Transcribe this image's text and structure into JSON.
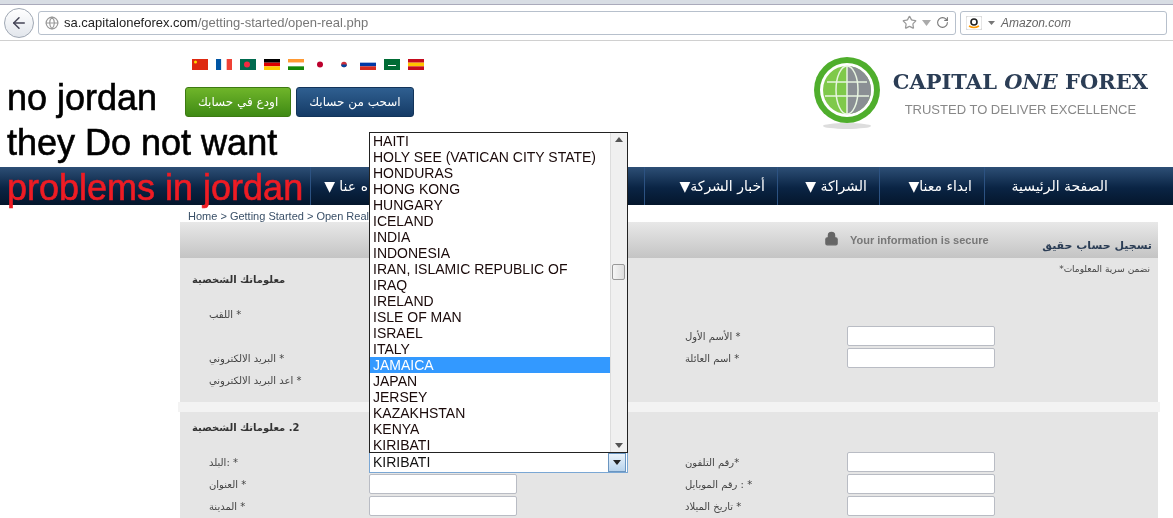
{
  "browser": {
    "url_domain": "sa.capitaloneforex.com",
    "url_path": "/getting-started/open-real.php",
    "search_placeholder": "Amazon.com"
  },
  "annotations": [
    {
      "text": "no jordan",
      "kind": "plain"
    },
    {
      "text": "they Do not want",
      "kind": "plain"
    },
    {
      "text": "problems in jordan",
      "kind": "alert"
    }
  ],
  "header": {
    "buttons": [
      {
        "label": "اسحب من حسابك",
        "kind": "withdraw"
      },
      {
        "label": "اودع في حسابك",
        "kind": "deposit"
      }
    ],
    "logo": {
      "name": "CAPITAL *ONE* FOREX",
      "tagline": "TRUSTED TO DELIVER EXCELLENCE"
    }
  },
  "nav": [
    {
      "label": "الصفحة الرئيسية"
    },
    {
      "label": "ابداء معنا▼"
    },
    {
      "label": "الشراكة ▼"
    },
    {
      "label": "أخبار الشركة▼"
    },
    {
      "label": "ه عنا ▼"
    }
  ],
  "breadcrumb": "Home > Getting Started > Open Real",
  "form": {
    "title": "تسجيل حساب حقيق",
    "secure_note": "Your information is secure",
    "privacy_note": "نضمن سرية المعلومات*",
    "sections": [
      {
        "title": "معلوماتك الشخصية",
        "rows": [
          {
            "left": {
              "label": "* اللقب",
              "kind": "text"
            }
          },
          {
            "right": {
              "label": "* الأسم الأول",
              "kind": "input"
            }
          },
          {
            "left": {
              "label": "* البريد الالكتروني",
              "kind": "text"
            },
            "right": {
              "label": "* اسم العائلة",
              "kind": "input"
            }
          },
          {
            "left": {
              "label": "* اعد البريد الالكتروني",
              "kind": "text"
            }
          }
        ]
      },
      {
        "title": "2. معلوماتك الشخصية",
        "rows": [
          {
            "left": {
              "label": "* :البلد",
              "kind": "select",
              "value": "KIRIBATI"
            },
            "right": {
              "label": "*رقم التلفون",
              "kind": "input"
            }
          },
          {
            "left": {
              "label": "* العنوان",
              "kind": "input"
            },
            "right": {
              "label": "* : رقم الموبايل",
              "kind": "input"
            }
          },
          {
            "left": {
              "label": "* المدينة",
              "kind": "input"
            },
            "right": {
              "label": "* تاريخ الميلاد",
              "kind": "input"
            }
          }
        ]
      }
    ]
  },
  "country_dropdown": {
    "options": [
      {
        "label": "HAITI",
        "selected": false
      },
      {
        "label": "HOLY SEE (VATICAN CITY STATE)",
        "selected": false
      },
      {
        "label": "HONDURAS",
        "selected": false
      },
      {
        "label": "HONG KONG",
        "selected": false
      },
      {
        "label": "HUNGARY",
        "selected": false
      },
      {
        "label": "ICELAND",
        "selected": false
      },
      {
        "label": "INDIA",
        "selected": false
      },
      {
        "label": "INDONESIA",
        "selected": false
      },
      {
        "label": "IRAN, ISLAMIC REPUBLIC OF",
        "selected": false
      },
      {
        "label": "IRAQ",
        "selected": false
      },
      {
        "label": "IRELAND",
        "selected": false
      },
      {
        "label": "ISLE OF MAN",
        "selected": false
      },
      {
        "label": "ISRAEL",
        "selected": false
      },
      {
        "label": "ITALY",
        "selected": false
      },
      {
        "label": "JAMAICA",
        "selected": true
      },
      {
        "label": "JAPAN",
        "selected": false
      },
      {
        "label": "JERSEY",
        "selected": false
      },
      {
        "label": "KAZAKHSTAN",
        "selected": false
      },
      {
        "label": "KENYA",
        "selected": false
      },
      {
        "label": "KIRIBATI",
        "selected": false
      }
    ]
  }
}
